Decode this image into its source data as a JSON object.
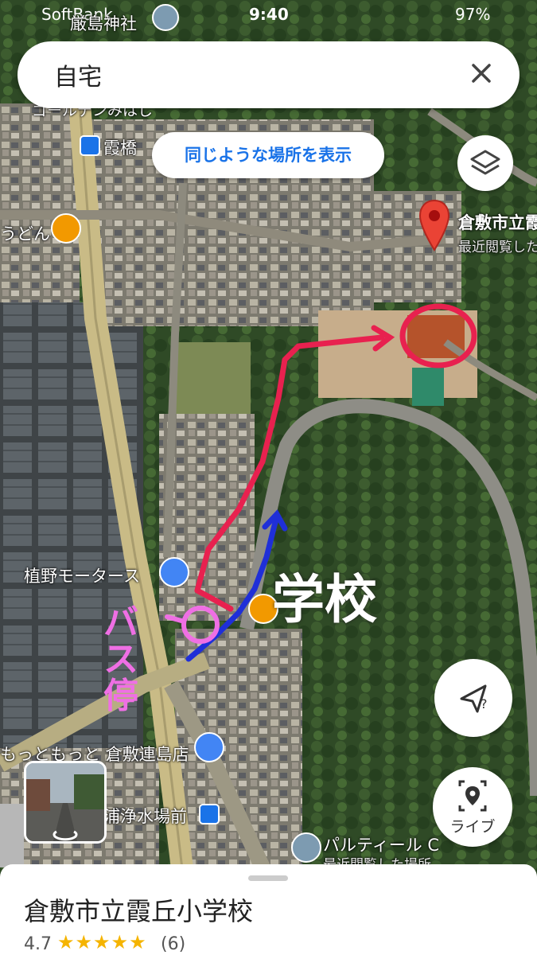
{
  "status_bar": {
    "carrier": "SoftBank",
    "time": "9:40",
    "battery": "97%"
  },
  "search": {
    "query": "自宅"
  },
  "similar_places_chip": "同じような場所を表示",
  "map_labels": {
    "shrine": "厳島神社",
    "area_top": "ゴールデンみはし",
    "bus_stop_top": "霞橋",
    "udon": "うどん",
    "destination_name": "倉敷市立霞",
    "destination_sub": "最近閲覧した",
    "motors": "植野モータース",
    "motto": "もっともっと 倉敷連島店",
    "bus_stop_bottom": "浦浄水場前",
    "parutiru": "パルティール C",
    "parutiru_sub": "最近閲覧した場所"
  },
  "annotations": {
    "bus_stop_handwritten": "バス停",
    "school_handwritten": "学校"
  },
  "buttons": {
    "live_label": "ライブ"
  },
  "place_sheet": {
    "name": "倉敷市立霞丘小学校",
    "rating": "4.7",
    "stars": "★★★★★",
    "review_count": "(6)"
  }
}
